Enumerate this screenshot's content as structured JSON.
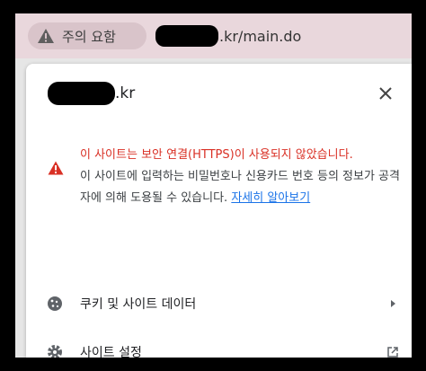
{
  "address_bar": {
    "warning_label": "주의 요함",
    "url_suffix": ".kr/main.do"
  },
  "popup": {
    "site_suffix": ".kr",
    "security": {
      "title": "이 사이트는 보안 연결(HTTPS)이 사용되지 않았습니다.",
      "description": "이 사이트에 입력하는 비밀번호나 신용카드 번호 등의 정보가 공격자에 의해 도용될 수 있습니다.",
      "link": "자세히 알아보기"
    },
    "menu": {
      "cookies_label": "쿠키 및 사이트 데이터",
      "settings_label": "사이트 설정"
    }
  },
  "colors": {
    "warning_red": "#d93025",
    "link_blue": "#1a73e8",
    "address_bar_bg": "#e9d7dc"
  }
}
